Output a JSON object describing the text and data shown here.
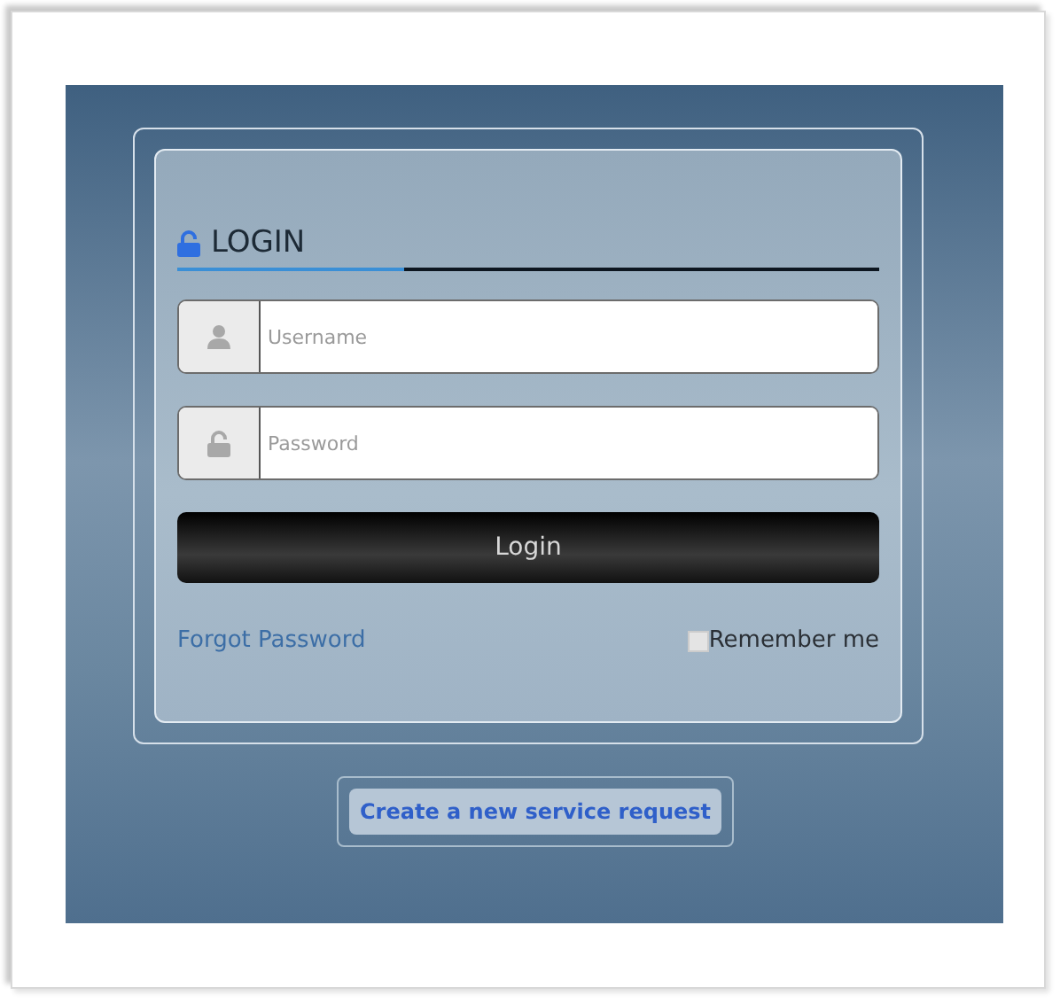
{
  "login_card": {
    "title": "LOGIN",
    "fields": [
      {
        "kind": "user",
        "placeholder": "Username"
      },
      {
        "kind": "lock",
        "placeholder": "Password"
      }
    ],
    "submit": "Login",
    "forgot_link": "Forgot Password",
    "remember": {
      "label": "Remember me",
      "checked": false
    }
  },
  "service_request": "Create a new service request"
}
